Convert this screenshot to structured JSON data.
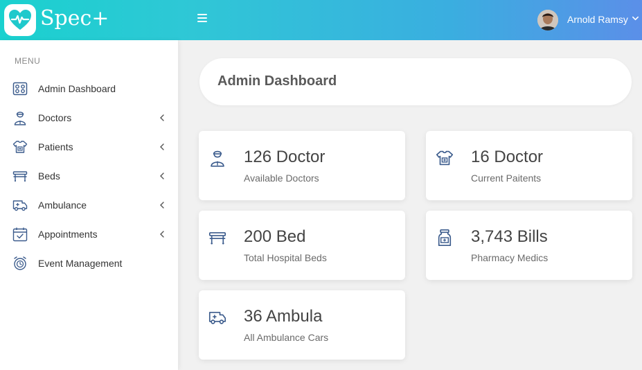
{
  "brand": {
    "name": "Spec+"
  },
  "header": {
    "user_name": "Arnold Ramsy"
  },
  "sidebar": {
    "menu_title": "MENU",
    "items": [
      {
        "label": "Admin Dashboard",
        "icon": "dashboard-icon",
        "has_submenu": false
      },
      {
        "label": "Doctors",
        "icon": "doctor-icon",
        "has_submenu": true
      },
      {
        "label": "Patients",
        "icon": "patient-icon",
        "has_submenu": true
      },
      {
        "label": "Beds",
        "icon": "bed-icon",
        "has_submenu": true
      },
      {
        "label": "Ambulance",
        "icon": "ambulance-icon",
        "has_submenu": true
      },
      {
        "label": "Appointments",
        "icon": "calendar-icon",
        "has_submenu": true
      },
      {
        "label": "Event Management",
        "icon": "event-icon",
        "has_submenu": false
      }
    ]
  },
  "main": {
    "title": "Admin Dashboard",
    "stats": [
      {
        "value": "126 Doctor",
        "label": "Available Doctors",
        "icon": "doctor-icon"
      },
      {
        "value": "16 Doctor",
        "label": "Current Paitents",
        "icon": "patient-icon"
      },
      {
        "value": "200 Bed",
        "label": "Total Hospital Beds",
        "icon": "bed-icon"
      },
      {
        "value": "3,743 Bills",
        "label": "Pharmacy Medics",
        "icon": "medicine-bottle-icon"
      },
      {
        "value": "36 Ambula",
        "label": "All Ambulance Cars",
        "icon": "ambulance-icon"
      }
    ]
  },
  "colors": {
    "header_gradient_start": "#1ad1cf",
    "header_gradient_end": "#5b8fe8",
    "icon_blue": "#3b5b8c",
    "background": "#f1f1f1"
  }
}
